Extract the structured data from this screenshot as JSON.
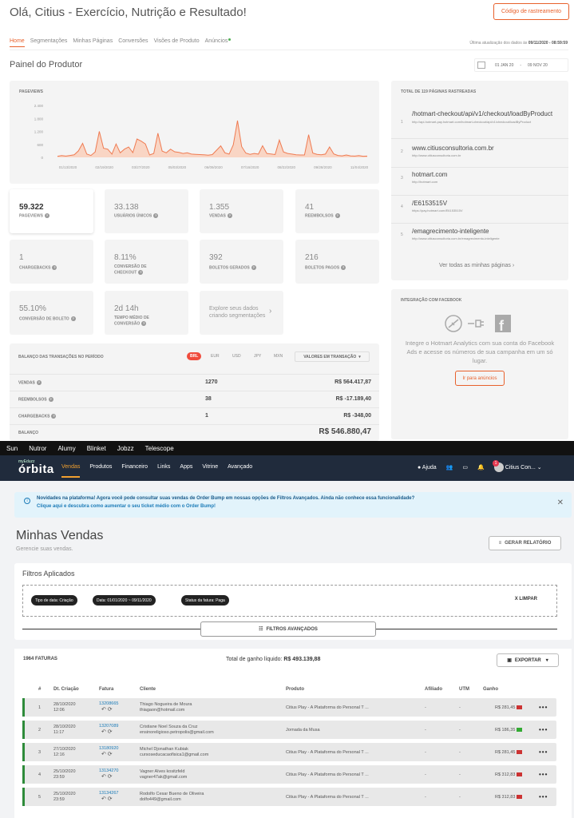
{
  "top": {
    "title": "Olá, Citius - Exercício, Nutrição e Resultado!",
    "tracking_btn": "Código de rastreamento",
    "tabs": [
      "Home",
      "Segmentações",
      "Minhas Páginas",
      "Conversões",
      "Visões de Produto",
      "Anúncios"
    ],
    "updated": "Última atualização dos dados às",
    "updated_val": "09/11/2020 - 08:59:59",
    "painel": "Painel do Produtor",
    "date_from": "01 JAN 20",
    "date_sep": "-",
    "date_to": "09 NOV 20"
  },
  "chart_data": {
    "type": "line",
    "title": "PAGEVIEWS",
    "x_ticks": [
      "01/13/2020",
      "02/19/2020",
      "03/27/2020",
      "05/03/2020",
      "06/09/2020",
      "07/16/2020",
      "08/22/2020",
      "09/28/2020",
      "11/04/2020"
    ],
    "y_ticks": [
      "2.400",
      "1.800",
      "1.200",
      "600",
      "0"
    ],
    "ylim": [
      0,
      2400
    ],
    "values": [
      50,
      80,
      60,
      90,
      120,
      300,
      650,
      150,
      90,
      250,
      1200,
      420,
      380,
      150,
      620,
      210,
      380,
      480,
      220,
      850,
      750,
      620,
      110,
      180,
      1120,
      290,
      210,
      380,
      260,
      230,
      180,
      210,
      150,
      140,
      130,
      120,
      100,
      130,
      330,
      530,
      210,
      150,
      580,
      1700,
      500,
      200,
      140,
      180,
      150,
      540,
      180,
      160,
      130,
      800,
      250,
      180,
      150,
      120,
      110,
      110,
      1050,
      200,
      140,
      120,
      150,
      480,
      160,
      90,
      70,
      110,
      70,
      60,
      80,
      50,
      60
    ]
  },
  "stats": [
    {
      "value": "59.322",
      "label": "PAGEVIEWS"
    },
    {
      "value": "33.138",
      "label": "USUÁRIOS ÚNICOS"
    },
    {
      "value": "1.355",
      "label": "VENDAS"
    },
    {
      "value": "41",
      "label": "REEMBOLSOS"
    },
    {
      "value": "1",
      "label": "CHARGEBACKS"
    },
    {
      "value": "8.11%",
      "label": "CONVERSÃO DE CHECKOUT"
    },
    {
      "value": "392",
      "label": "BOLETOS GERADOS"
    },
    {
      "value": "216",
      "label": "BOLETOS PAGOS"
    },
    {
      "value": "55.10%",
      "label": "CONVERSÃO DE BOLETO"
    },
    {
      "value": "2d 14h",
      "label": "TEMPO MÉDIO DE CONVERSÃO"
    }
  ],
  "explore": "Explore seus dados criando segmentações",
  "pages": {
    "title": "TOTAL DE 119 PÁGINAS RASTREADAS",
    "items": [
      {
        "n": "1",
        "t": "/hotmart-checkout/api/v1/checkout/loadByProduct",
        "s": "http://api-hotmart-pay.hotmart.com/hotmart-checkout/api/v1/checkout/loadByProduct"
      },
      {
        "n": "2",
        "t": "www.citiusconsultoria.com.br",
        "s": "http://www.citiusconsultoria.com.br"
      },
      {
        "n": "3",
        "t": "hotmart.com",
        "s": "http://hotmart.com"
      },
      {
        "n": "4",
        "t": "/E6153515V",
        "s": "https://pay.hotmart.com/E6153515V"
      },
      {
        "n": "5",
        "t": "/emagrecimento-inteligente",
        "s": "http://www.citiusconsultoria.com.br/emagrecimento-inteligente"
      }
    ],
    "more": "Ver todas as minhas páginas"
  },
  "fb": {
    "title": "INTEGRAÇÃO COM FACEBOOK",
    "text": "Integre o Hotmart Analytics com sua conta do Facebook Ads e acesse os números de sua campanha em um só lugar.",
    "btn": "Ir para anúncios"
  },
  "balanco": {
    "title": "BALANÇO DAS TRANSAÇÕES NO PERÍODO",
    "currencies": [
      "BRL",
      "EUR",
      "USD",
      "JPY",
      "MXN"
    ],
    "dropdown": "VALORES EM TRANSAÇÃO",
    "rows": [
      {
        "a": "VENDAS",
        "b": "1270",
        "c": "R$ 564.417,87"
      },
      {
        "a": "REEMBOLSOS",
        "b": "38",
        "c": "R$ -17.189,40"
      },
      {
        "a": "CHARGEBACKS",
        "b": "1",
        "c": "R$ -348,00"
      },
      {
        "a": "BALANÇO",
        "b": "",
        "c": "R$ 546.880,47"
      }
    ]
  },
  "bookmarks": [
    "Sun",
    "Nutror",
    "Alumy",
    "Blinket",
    "Jobzz",
    "Telescope"
  ],
  "nav": {
    "logo_small": "myEduzz",
    "logo": "órbita",
    "menu": [
      "Vendas",
      "Produtos",
      "Financeiro",
      "Links",
      "Apps",
      "Vitrine",
      "Avançado"
    ],
    "help": "Ajuda",
    "badge": "1",
    "user": "Citius Con..."
  },
  "info": {
    "line1": "Novidades na plataforma! Agora você pode consultar suas vendas de Order Bump em nossas opções de Filtros Avançados. Ainda não conhece essa funcionalidade?",
    "line2": "Clique aqui e descubra como aumentar o seu ticket médio com o Order Bump!"
  },
  "vendas": {
    "title": "Minhas Vendas",
    "subtitle": "Gerencie suas vendas.",
    "report": "GERAR RELATÓRIO",
    "filters_title": "Filtros Aplicados",
    "chips": [
      "Tipo de data: Criação",
      "Data: 01/01/2020 ~ 09/11/2020",
      "Status da fatura: Paga"
    ],
    "clear": "X LIMPAR",
    "advanced": "FILTROS AVANÇADOS",
    "count": "1964 FATURAS",
    "total_label": "Total de ganho líquido:",
    "total_value": "R$ 493.139,88",
    "export": "EXPORTAR",
    "headers": [
      "#",
      "Dt. Criação",
      "Fatura",
      "Cliente",
      "Produto",
      "Afiliado",
      "UTM",
      "Ganho"
    ],
    "rows": [
      {
        "n": "1",
        "d": "28/10/2020",
        "h": "12:06",
        "f": "13208665",
        "c": "Thiago Nogueira de Moura",
        "e": "thiagaon@hotmail.com",
        "p": "Citius Play - A Plataforma do Personal T ...",
        "a": "-",
        "u": "-",
        "g": "R$ 281,45"
      },
      {
        "n": "2",
        "d": "28/10/2020",
        "h": "11:17",
        "f": "13207089",
        "c": "Cristiane Noel Souza da Cruz",
        "e": "ensinoreligioso.petropolis@gmail.com",
        "p": "Jornada da Musa",
        "a": "-",
        "u": "-",
        "g": "R$ 186,35"
      },
      {
        "n": "3",
        "d": "27/10/2020",
        "h": "12:16",
        "f": "13180920",
        "c": "Michel Djonathan Kubiak",
        "e": "cursoseducacaofisica1@gmail.com",
        "p": "Citius Play - A Plataforma do Personal T ...",
        "a": "-",
        "u": "-",
        "g": "R$ 281,45"
      },
      {
        "n": "4",
        "d": "25/10/2020",
        "h": "23:59",
        "f": "13134270",
        "c": "Vagner Alves kositzfeld",
        "e": "vagner47ak@gmail.com",
        "p": "Citius Play - A Plataforma do Personal T ...",
        "a": "-",
        "u": "-",
        "g": "R$ 312,83"
      },
      {
        "n": "5",
        "d": "25/10/2020",
        "h": "23:59",
        "f": "13134267",
        "c": "Rodolfo Cesar Bueno de Oliveira",
        "e": "dolfo449@gmail.com",
        "p": "Citius Play - A Plataforma do Personal T ...",
        "a": "-",
        "u": "-",
        "g": "R$ 312,83"
      }
    ]
  }
}
